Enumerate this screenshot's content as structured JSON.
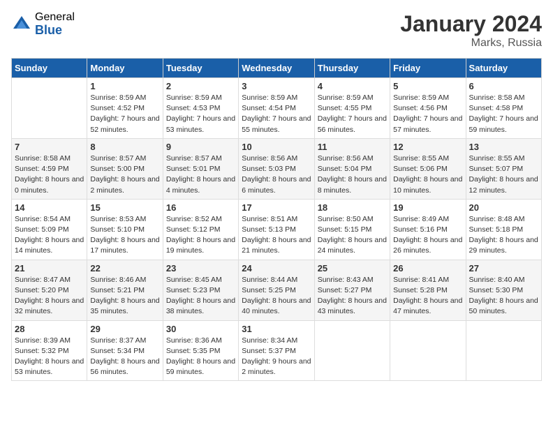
{
  "logo": {
    "general": "General",
    "blue": "Blue"
  },
  "header": {
    "month": "January 2024",
    "location": "Marks, Russia"
  },
  "days_of_week": [
    "Sunday",
    "Monday",
    "Tuesday",
    "Wednesday",
    "Thursday",
    "Friday",
    "Saturday"
  ],
  "weeks": [
    [
      {
        "day": "",
        "sunrise": "",
        "sunset": "",
        "daylight": ""
      },
      {
        "day": "1",
        "sunrise": "Sunrise: 8:59 AM",
        "sunset": "Sunset: 4:52 PM",
        "daylight": "Daylight: 7 hours and 52 minutes."
      },
      {
        "day": "2",
        "sunrise": "Sunrise: 8:59 AM",
        "sunset": "Sunset: 4:53 PM",
        "daylight": "Daylight: 7 hours and 53 minutes."
      },
      {
        "day": "3",
        "sunrise": "Sunrise: 8:59 AM",
        "sunset": "Sunset: 4:54 PM",
        "daylight": "Daylight: 7 hours and 55 minutes."
      },
      {
        "day": "4",
        "sunrise": "Sunrise: 8:59 AM",
        "sunset": "Sunset: 4:55 PM",
        "daylight": "Daylight: 7 hours and 56 minutes."
      },
      {
        "day": "5",
        "sunrise": "Sunrise: 8:59 AM",
        "sunset": "Sunset: 4:56 PM",
        "daylight": "Daylight: 7 hours and 57 minutes."
      },
      {
        "day": "6",
        "sunrise": "Sunrise: 8:58 AM",
        "sunset": "Sunset: 4:58 PM",
        "daylight": "Daylight: 7 hours and 59 minutes."
      }
    ],
    [
      {
        "day": "7",
        "sunrise": "Sunrise: 8:58 AM",
        "sunset": "Sunset: 4:59 PM",
        "daylight": "Daylight: 8 hours and 0 minutes."
      },
      {
        "day": "8",
        "sunrise": "Sunrise: 8:57 AM",
        "sunset": "Sunset: 5:00 PM",
        "daylight": "Daylight: 8 hours and 2 minutes."
      },
      {
        "day": "9",
        "sunrise": "Sunrise: 8:57 AM",
        "sunset": "Sunset: 5:01 PM",
        "daylight": "Daylight: 8 hours and 4 minutes."
      },
      {
        "day": "10",
        "sunrise": "Sunrise: 8:56 AM",
        "sunset": "Sunset: 5:03 PM",
        "daylight": "Daylight: 8 hours and 6 minutes."
      },
      {
        "day": "11",
        "sunrise": "Sunrise: 8:56 AM",
        "sunset": "Sunset: 5:04 PM",
        "daylight": "Daylight: 8 hours and 8 minutes."
      },
      {
        "day": "12",
        "sunrise": "Sunrise: 8:55 AM",
        "sunset": "Sunset: 5:06 PM",
        "daylight": "Daylight: 8 hours and 10 minutes."
      },
      {
        "day": "13",
        "sunrise": "Sunrise: 8:55 AM",
        "sunset": "Sunset: 5:07 PM",
        "daylight": "Daylight: 8 hours and 12 minutes."
      }
    ],
    [
      {
        "day": "14",
        "sunrise": "Sunrise: 8:54 AM",
        "sunset": "Sunset: 5:09 PM",
        "daylight": "Daylight: 8 hours and 14 minutes."
      },
      {
        "day": "15",
        "sunrise": "Sunrise: 8:53 AM",
        "sunset": "Sunset: 5:10 PM",
        "daylight": "Daylight: 8 hours and 17 minutes."
      },
      {
        "day": "16",
        "sunrise": "Sunrise: 8:52 AM",
        "sunset": "Sunset: 5:12 PM",
        "daylight": "Daylight: 8 hours and 19 minutes."
      },
      {
        "day": "17",
        "sunrise": "Sunrise: 8:51 AM",
        "sunset": "Sunset: 5:13 PM",
        "daylight": "Daylight: 8 hours and 21 minutes."
      },
      {
        "day": "18",
        "sunrise": "Sunrise: 8:50 AM",
        "sunset": "Sunset: 5:15 PM",
        "daylight": "Daylight: 8 hours and 24 minutes."
      },
      {
        "day": "19",
        "sunrise": "Sunrise: 8:49 AM",
        "sunset": "Sunset: 5:16 PM",
        "daylight": "Daylight: 8 hours and 26 minutes."
      },
      {
        "day": "20",
        "sunrise": "Sunrise: 8:48 AM",
        "sunset": "Sunset: 5:18 PM",
        "daylight": "Daylight: 8 hours and 29 minutes."
      }
    ],
    [
      {
        "day": "21",
        "sunrise": "Sunrise: 8:47 AM",
        "sunset": "Sunset: 5:20 PM",
        "daylight": "Daylight: 8 hours and 32 minutes."
      },
      {
        "day": "22",
        "sunrise": "Sunrise: 8:46 AM",
        "sunset": "Sunset: 5:21 PM",
        "daylight": "Daylight: 8 hours and 35 minutes."
      },
      {
        "day": "23",
        "sunrise": "Sunrise: 8:45 AM",
        "sunset": "Sunset: 5:23 PM",
        "daylight": "Daylight: 8 hours and 38 minutes."
      },
      {
        "day": "24",
        "sunrise": "Sunrise: 8:44 AM",
        "sunset": "Sunset: 5:25 PM",
        "daylight": "Daylight: 8 hours and 40 minutes."
      },
      {
        "day": "25",
        "sunrise": "Sunrise: 8:43 AM",
        "sunset": "Sunset: 5:27 PM",
        "daylight": "Daylight: 8 hours and 43 minutes."
      },
      {
        "day": "26",
        "sunrise": "Sunrise: 8:41 AM",
        "sunset": "Sunset: 5:28 PM",
        "daylight": "Daylight: 8 hours and 47 minutes."
      },
      {
        "day": "27",
        "sunrise": "Sunrise: 8:40 AM",
        "sunset": "Sunset: 5:30 PM",
        "daylight": "Daylight: 8 hours and 50 minutes."
      }
    ],
    [
      {
        "day": "28",
        "sunrise": "Sunrise: 8:39 AM",
        "sunset": "Sunset: 5:32 PM",
        "daylight": "Daylight: 8 hours and 53 minutes."
      },
      {
        "day": "29",
        "sunrise": "Sunrise: 8:37 AM",
        "sunset": "Sunset: 5:34 PM",
        "daylight": "Daylight: 8 hours and 56 minutes."
      },
      {
        "day": "30",
        "sunrise": "Sunrise: 8:36 AM",
        "sunset": "Sunset: 5:35 PM",
        "daylight": "Daylight: 8 hours and 59 minutes."
      },
      {
        "day": "31",
        "sunrise": "Sunrise: 8:34 AM",
        "sunset": "Sunset: 5:37 PM",
        "daylight": "Daylight: 9 hours and 2 minutes."
      },
      {
        "day": "",
        "sunrise": "",
        "sunset": "",
        "daylight": ""
      },
      {
        "day": "",
        "sunrise": "",
        "sunset": "",
        "daylight": ""
      },
      {
        "day": "",
        "sunrise": "",
        "sunset": "",
        "daylight": ""
      }
    ]
  ]
}
